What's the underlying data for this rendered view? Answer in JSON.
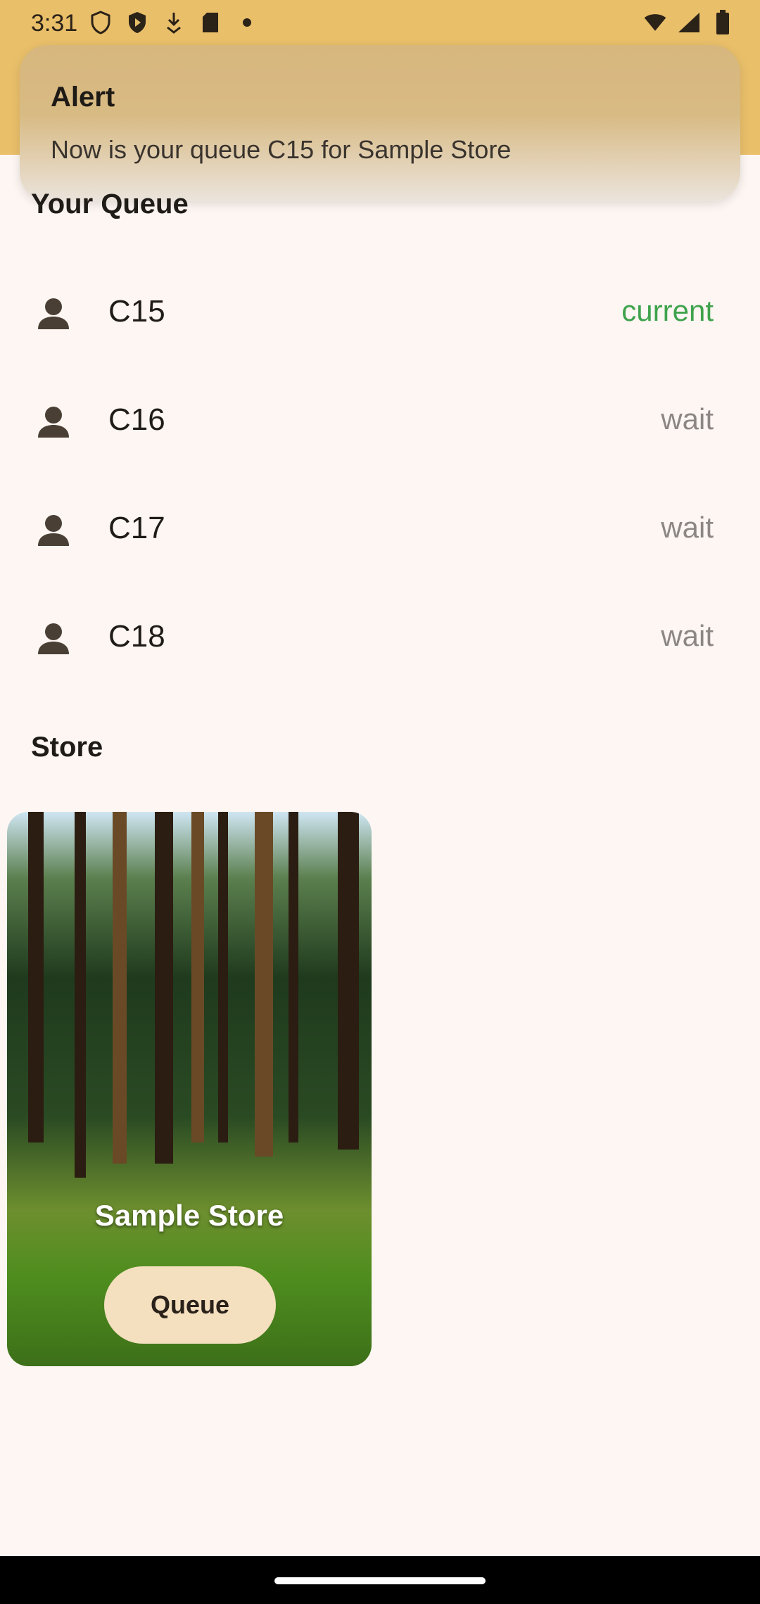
{
  "status_bar": {
    "time": "3:31"
  },
  "alert": {
    "title": "Alert",
    "message": "Now is your queue C15 for Sample Store"
  },
  "your_queue": {
    "title": "Your Queue",
    "items": [
      {
        "label": "C15",
        "status": "current"
      },
      {
        "label": "C16",
        "status": "wait"
      },
      {
        "label": "C17",
        "status": "wait"
      },
      {
        "label": "C18",
        "status": "wait"
      }
    ]
  },
  "store": {
    "title": "Store",
    "card": {
      "name": "Sample Store",
      "button": "Queue"
    }
  },
  "colors": {
    "appbar": "#e9bf6a",
    "current_status": "#3fa34d",
    "wait_status": "#8c8784",
    "queue_button": "#f4dfbf"
  }
}
